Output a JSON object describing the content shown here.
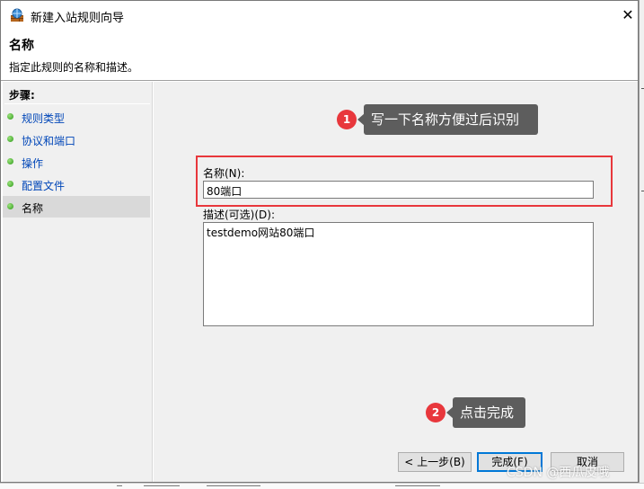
{
  "window": {
    "title": "新建入站规则向导",
    "close_glyph": "✕"
  },
  "header": {
    "title": "名称",
    "subtitle": "指定此规则的名称和描述。"
  },
  "steps": {
    "heading": "步骤:",
    "items": [
      {
        "label": "规则类型",
        "active": false
      },
      {
        "label": "协议和端口",
        "active": false
      },
      {
        "label": "操作",
        "active": false
      },
      {
        "label": "配置文件",
        "active": false
      },
      {
        "label": "名称",
        "active": true
      }
    ]
  },
  "form": {
    "name_label": "名称(N):",
    "name_value": "80端口",
    "desc_label": "描述(可选)(D):",
    "desc_value": "testdemo网站80端口"
  },
  "annotations": [
    {
      "number": "1",
      "text": "写一下名称方便过后识别"
    },
    {
      "number": "2",
      "text": "点击完成"
    }
  ],
  "buttons": {
    "back": "< 上一步(B)",
    "finish": "完成(F)",
    "cancel": "取消"
  },
  "watermark": "CSDN @西瓜皮哦",
  "colors": {
    "annotation_red": "#e8373c",
    "callout_bg": "#5d5d5d",
    "link_blue": "#0046b8",
    "step_dot_green": "#2e9a1c"
  }
}
